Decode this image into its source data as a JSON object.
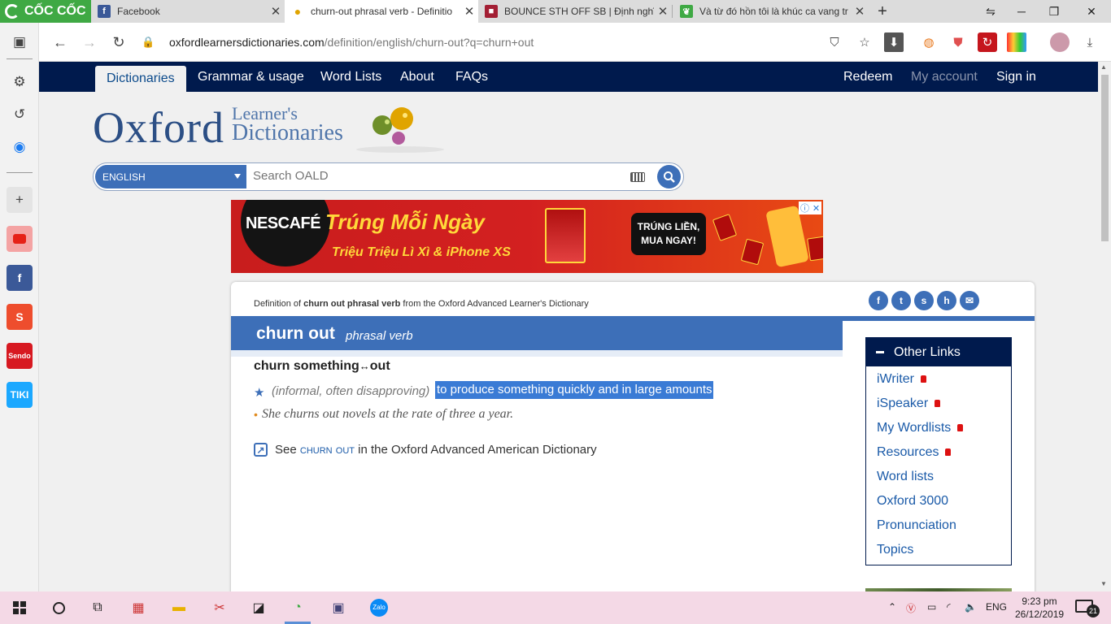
{
  "browser": {
    "brand": "CỐC CỐC",
    "tabs": [
      {
        "title": "Facebook",
        "favicon": "facebook-icon",
        "color": "#3b5998"
      },
      {
        "title": "churn-out phrasal verb - Definitio",
        "favicon": "oxford-icon",
        "color": "#ffffff"
      },
      {
        "title": "BOUNCE STH OFF SB | Định nghĩa",
        "favicon": "cambridge-icon",
        "color": "#a31f34"
      },
      {
        "title": "Và từ đó hồn tôi là khúc ca vang tr",
        "favicon": "leaf-icon",
        "color": "#3fa944"
      }
    ],
    "url": {
      "host": "oxfordlearnersdictionaries.com",
      "path": "/definition/english/churn-out?q=churn+out"
    }
  },
  "nav": {
    "items": [
      "Dictionaries",
      "Grammar & usage",
      "Word Lists",
      "About",
      "FAQs"
    ],
    "right": [
      "Redeem",
      "My account",
      "Sign in"
    ]
  },
  "logo": {
    "main": "Oxford",
    "line1": "Learner's",
    "line2": "Dictionaries"
  },
  "search": {
    "language": "ENGLISH",
    "placeholder": "Search OALD"
  },
  "ad": {
    "brand": "NESCAFÉ",
    "headline": "Trúng Mỗi Ngày",
    "subline": "Triệu Triệu Lì Xì & iPhone XS",
    "cta_line1": "TRÚNG LIỀN,",
    "cta_line2": "MUA NGAY!"
  },
  "entry": {
    "source_prefix": "Definition of",
    "source_term": "churn out phrasal verb",
    "source_suffix": "from the Oxford Advanced Learner's Dictionary",
    "headword": "churn out",
    "pos": "phrasal verb",
    "collocation": "churn something",
    "collocation_tail": "out",
    "labels": "(informal, often disapproving)",
    "definition": "to produce something quickly and in large amounts",
    "example": "She churns out novels at the rate of three a year.",
    "see_prefix": "See",
    "see_term": "churn out",
    "see_suffix": "in the Oxford Advanced American Dictionary"
  },
  "other_links": {
    "title": "Other Links",
    "items": [
      {
        "label": "iWriter",
        "locked": true
      },
      {
        "label": "iSpeaker",
        "locked": true
      },
      {
        "label": "My Wordlists",
        "locked": true
      },
      {
        "label": "Resources",
        "locked": true
      },
      {
        "label": "Word lists",
        "locked": false
      },
      {
        "label": "Oxford 3000",
        "locked": false
      },
      {
        "label": "Pronunciation",
        "locked": false
      },
      {
        "label": "Topics",
        "locked": false
      }
    ]
  },
  "taskbar": {
    "language": "ENG",
    "time": "9:23 pm",
    "date": "26/12/2019",
    "notifications": "21"
  }
}
